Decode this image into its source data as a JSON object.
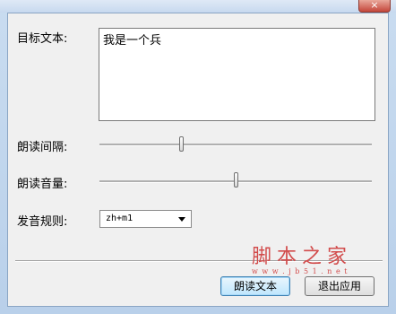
{
  "window": {
    "close_glyph": "×"
  },
  "form": {
    "target_text_label": "目标文本:",
    "target_text_value": "我是一个兵",
    "interval_label": "朗读间隔:",
    "interval_value": 0.3,
    "volume_label": "朗读音量:",
    "volume_value": 0.5,
    "rule_label": "发音规则:",
    "rule_selected": "zh+m1"
  },
  "buttons": {
    "read": "朗读文本",
    "exit": "退出应用"
  },
  "watermark": {
    "title": "脚本之家",
    "subtitle": "w w w . j b 5 1 . n e t"
  }
}
